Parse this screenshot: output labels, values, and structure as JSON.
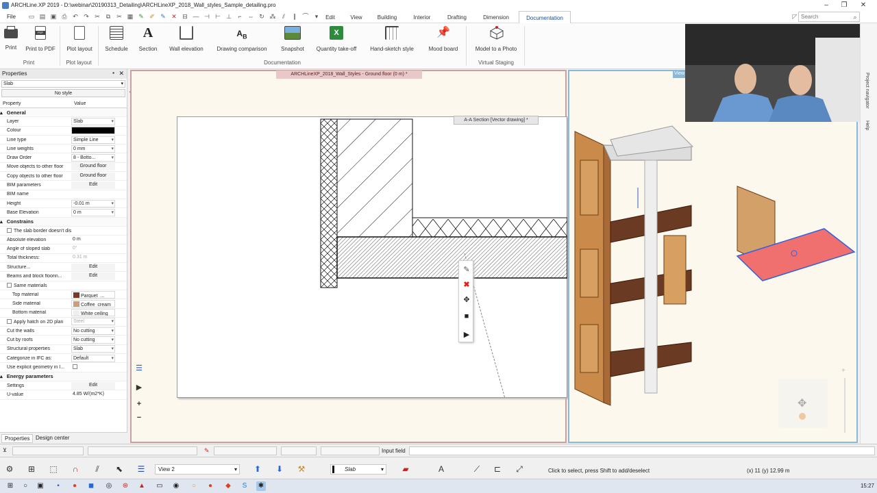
{
  "window": {
    "title": "ARCHLine.XP 2019 - D:\\webinar\\20190313_Detailing\\ARCHLineXP_2018_Wall_styles_Sample_detailing.pro"
  },
  "menu": {
    "file": "File",
    "tabs": [
      "Edit",
      "View",
      "Building",
      "Interior",
      "Drafting",
      "Dimension",
      "Documentation"
    ],
    "active": "Documentation",
    "search_placeholder": "Search"
  },
  "ribbon": {
    "buttons": [
      {
        "label": "Print",
        "icon": "printer-icon"
      },
      {
        "label": "Print to PDF",
        "icon": "pdf-icon"
      },
      {
        "label": "Plot layout",
        "icon": "plot-layout-icon"
      },
      {
        "label": "Schedule",
        "icon": "schedule-icon"
      },
      {
        "label": "Section",
        "icon": "section-icon"
      },
      {
        "label": "Wall elevation",
        "icon": "wall-elevation-icon"
      },
      {
        "label": "Drawing comparison",
        "icon": "drawing-comparison-icon"
      },
      {
        "label": "Snapshot",
        "icon": "snapshot-icon"
      },
      {
        "label": "Quantity take-off",
        "icon": "excel-icon"
      },
      {
        "label": "Hand-sketch style",
        "icon": "hand-sketch-icon"
      },
      {
        "label": "Mood board",
        "icon": "mood-board-icon"
      },
      {
        "label": "Model to a Photo",
        "icon": "model-photo-icon"
      }
    ],
    "groups": [
      "Print",
      "Plot layout",
      "Documentation",
      "Virtual Staging"
    ]
  },
  "properties": {
    "title": "Properties",
    "selector": "Slab",
    "style": "No style",
    "col_property": "Property",
    "col_value": "Value",
    "rows": [
      {
        "type": "section",
        "label": "General"
      },
      {
        "label": "Layer",
        "value": "Slab",
        "dd": true
      },
      {
        "label": "Colour",
        "value": "",
        "color": "#000000"
      },
      {
        "label": "Line type",
        "value": "Simple Line",
        "dd": true
      },
      {
        "label": "Line weights",
        "value": "0 mm",
        "dd": true
      },
      {
        "label": "Draw Order",
        "value": "8 - Botto...",
        "dd": true
      },
      {
        "label": "Move objects to other floor",
        "value": "Ground floor",
        "btn": true
      },
      {
        "label": "Copy objects to other floor",
        "value": "Ground floor",
        "btn": true
      },
      {
        "label": "BIM parameters",
        "value": "Edit",
        "btn": true
      },
      {
        "label": "BIM name",
        "value": "",
        "nb": true
      },
      {
        "label": "Height",
        "value": "-0.01 m",
        "dd": true
      },
      {
        "label": "Base Elevation",
        "value": "0 m",
        "dd": true
      },
      {
        "type": "section",
        "label": "Constrains"
      },
      {
        "label": "The slab border doesn't display on th...",
        "value": "",
        "check": true,
        "nb": true
      },
      {
        "label": "Absolute elevation",
        "value": "0 m",
        "nb": true
      },
      {
        "label": "Angle of sloped slab",
        "value": "0°",
        "nb": true,
        "dim": true
      },
      {
        "label": "Total thickness:",
        "value": "0.31 m",
        "nb": true,
        "dim": true
      },
      {
        "label": "Structure...",
        "value": "Edit",
        "btn": true
      },
      {
        "label": "Beams and block floorin...",
        "value": "Edit",
        "btn": true
      },
      {
        "label": "Same materials",
        "value": "",
        "check": true,
        "nb": true
      },
      {
        "label": "Top material",
        "value": "Parquet_...",
        "swatch": "#7a3a2a",
        "indent": true
      },
      {
        "label": "Side material",
        "value": "Coffee_cream",
        "swatch": "#c8a080",
        "indent": true
      },
      {
        "label": "Bottom material",
        "value": "White ceiling",
        "swatch": "#eeeeee",
        "indent": true
      },
      {
        "label": "Apply hatch on 2D plan",
        "value": "Steel",
        "check": true,
        "dim": true,
        "dd": true
      },
      {
        "label": "Cut the walls",
        "value": "No cutting",
        "dd": true
      },
      {
        "label": "Cut by roofs",
        "value": "No cutting",
        "dd": true
      },
      {
        "label": "Structural properties",
        "value": "Slab",
        "dd": true
      },
      {
        "label": "Categorize in IFC as:",
        "value": "Default",
        "dd": true
      },
      {
        "label": "Use explicit geometry in I...",
        "value": "",
        "vcheck": true,
        "nb": true
      },
      {
        "type": "section",
        "label": "Energy parameters"
      },
      {
        "label": "Settings",
        "value": "Edit",
        "btn": true
      },
      {
        "label": "U-value",
        "value": "4.85 W/(m2*K)",
        "nb": true
      }
    ],
    "tabs": [
      "Properties",
      "Design center"
    ]
  },
  "left_view": {
    "title": "ARCHLineXP_2018_Wall_Styles - Ground floor (0 m) *",
    "section_label": "A-A Section [Vector drawing] *"
  },
  "right_view": {
    "label": "View"
  },
  "right_sidebar": {
    "items": [
      "Project navigator",
      "Help"
    ]
  },
  "input_bar": {
    "label": "Input field"
  },
  "status": {
    "view": "View 2",
    "layer": "Slab",
    "message": "Click to select, press Shift to add/deselect",
    "coords": "(x) 11  (y) 12.99 m"
  },
  "taskbar": {
    "clock": "15:27"
  }
}
